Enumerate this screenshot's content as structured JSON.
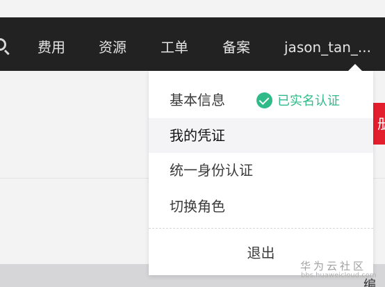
{
  "navbar": {
    "items": [
      "费用",
      "资源",
      "工单",
      "备案"
    ],
    "user": "jason_tan_..."
  },
  "dropdown": {
    "basic_info": "基本信息",
    "verified_badge": "已实名认证",
    "my_credentials": "我的凭证",
    "unified_identity": "统一身份认证",
    "switch_role": "切换角色",
    "logout": "退出"
  },
  "side": {
    "red_tab": "册",
    "bottom_text": "编..."
  },
  "watermark": {
    "site": "华为云社区",
    "url": "bbs.huaweicloud.com"
  },
  "colors": {
    "navbar_bg": "#222223",
    "verified_green": "#2fbb89",
    "red_tab": "#e31e2d"
  },
  "icons": {
    "search": "search-icon",
    "verified": "check-circle-icon"
  }
}
